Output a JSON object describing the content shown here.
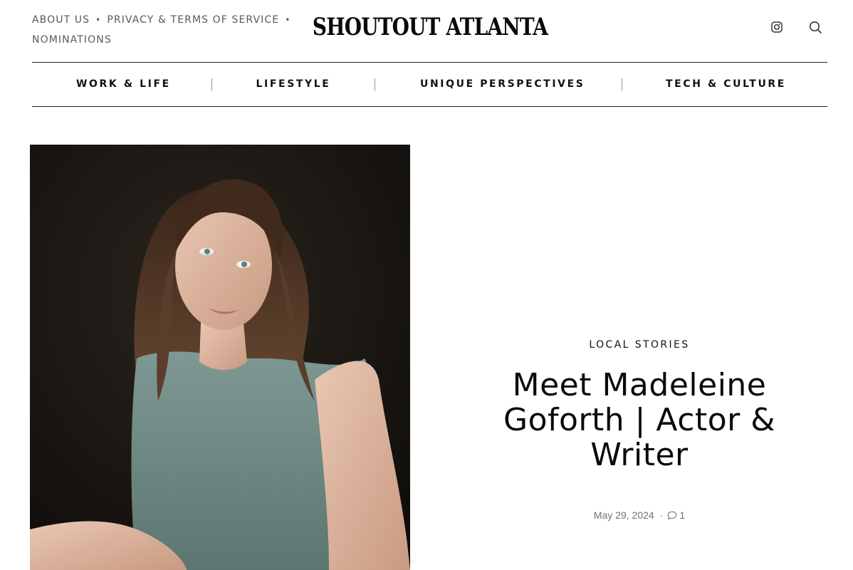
{
  "top_links": [
    {
      "label": "ABOUT US"
    },
    {
      "label": "PRIVACY & TERMS OF SERVICE"
    },
    {
      "label": "NOMINATIONS"
    }
  ],
  "separator": "•",
  "logo": "SHOUTOUT ATLANTA",
  "header_icons": [
    "instagram-icon",
    "search-icon"
  ],
  "nav": [
    {
      "label": "WORK & LIFE"
    },
    {
      "label": "LIFESTYLE"
    },
    {
      "label": "UNIQUE PERSPECTIVES"
    },
    {
      "label": "TECH & CULTURE"
    }
  ],
  "article": {
    "category": "LOCAL STORIES",
    "title": "Meet Madeleine Goforth | Actor & Writer",
    "date": "May 29, 2024",
    "meta_separator": "·",
    "comment_count": "1"
  },
  "colors": {
    "text": "#111111",
    "muted": "#6b7280",
    "top_links": "#555a66",
    "photo_background": "#15120f",
    "blouse": "#6f8a86"
  }
}
